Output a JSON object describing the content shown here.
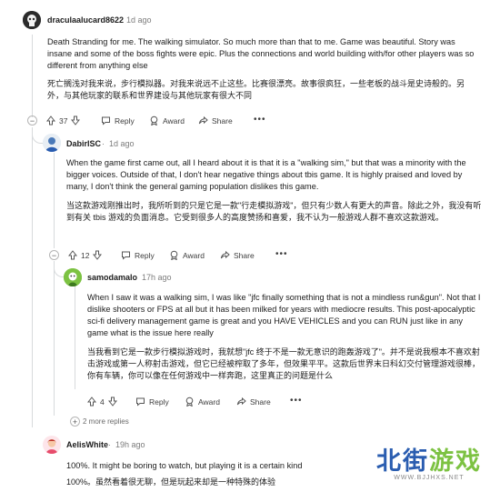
{
  "comments": [
    {
      "username": "draculaalucard8622",
      "time": "1d ago",
      "text_en": "Death Stranding for me. The walking simulator. So much more than that to me. Game was beautiful. Story was insane and some of the boss fights were epic. Plus the connections and world building with/for other players was so different from anything else",
      "text_zh": "死亡搁浅对我来说，步行模拟器。对我来说远不止这些。比赛很漂亮。故事很疯狂，一些老板的战斗是史诗般的。另外，与其他玩家的联系和世界建设与其他玩家有很大不同",
      "votes": "37",
      "actions": {
        "reply": "Reply",
        "award": "Award",
        "share": "Share"
      }
    },
    {
      "username": "DabirISC",
      "time": "1d ago",
      "text_en": "When the game first came out, all I heard about it is that it is a \"walking sim,\" but that was a minority with the bigger voices. Outside of that, I don't hear negative things about tbis game. It is highly praised and loved by many, I don't think the general gaming population dislikes this game.",
      "text_zh": "当这款游戏刚推出时，我所听到的只是它是一款\"行走模拟游戏\"，但只有少数人有更大的声音。除此之外，我没有听到有关 tbis 游戏的负面消息。它受到很多人的高度赞扬和喜爱，我不认为一般游戏人群不喜欢这款游戏。",
      "votes": "12",
      "actions": {
        "reply": "Reply",
        "award": "Award",
        "share": "Share"
      }
    },
    {
      "username": "samodamalo",
      "time": "17h ago",
      "text_en": "When I saw it was a walking sim, I was like \"jfc finally something that is not a mindless run&gun\". Not that I dislike shooters or FPS at all but it has been milked for years with mediocre results. This post-apocalyptic sci-fi delivery management game is great and you HAVE VEHICLES and you can RUN just like in any game what is the issue here really",
      "text_zh": "当我看到它是一款步行模拟游戏时，我就想\"jfc 终于不是一款无意识的跑轰游戏了\"。并不是说我根本不喜欢射击游戏或第一人称射击游戏，但它已经被榨取了多年，但效果平平。这款后世界末日科幻交付管理游戏很棒，你有车辆，你可以像在任何游戏中一样奔跑，这里真正的问题是什么",
      "votes": "4",
      "actions": {
        "reply": "Reply",
        "award": "Award",
        "share": "Share"
      }
    },
    {
      "username": "AelisWhite",
      "time": "19h ago",
      "text_en": "100%. It might be boring to watch, but playing it is a certain kind",
      "text_zh": "100%。虽然看着很无聊，但是玩起来却是一种特殊的体验"
    }
  ],
  "more_replies": "2 more replies",
  "watermark": {
    "logo": "北街游戏",
    "url": "WWW.BJJHXS.NET"
  },
  "colors": {
    "accent_blue": "#2a5db0",
    "accent_green": "#7cc242",
    "line": "#d7dadc"
  }
}
